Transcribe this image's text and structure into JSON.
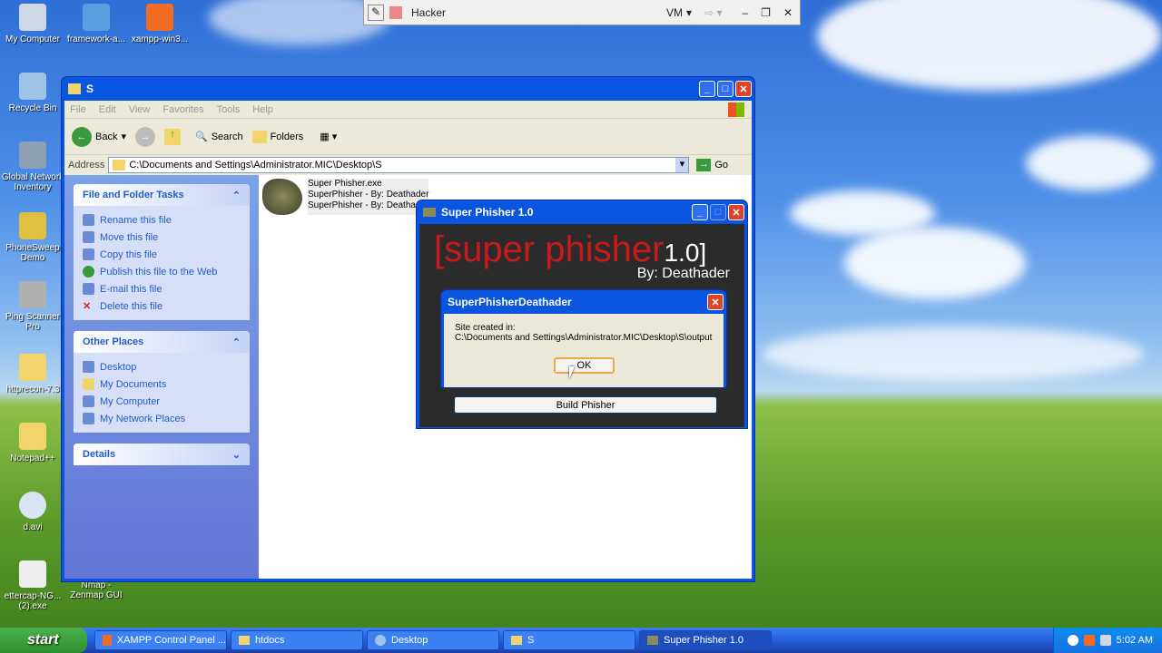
{
  "vm_bar": {
    "title": "Hacker",
    "vm_label": "VM"
  },
  "desktop_icons": [
    {
      "label": "My Computer"
    },
    {
      "label": "framework-a..."
    },
    {
      "label": "xampp-win3..."
    },
    {
      "label": "Recycle Bin"
    },
    {
      "label": "Global Network Inventory"
    },
    {
      "label": "PhoneSweep Demo"
    },
    {
      "label": "Ping Scanner Pro"
    },
    {
      "label": "httprecon-7.3"
    },
    {
      "label": "Notepad++"
    },
    {
      "label": "d.avi"
    },
    {
      "label": "ettercap-NG... (2).exe"
    },
    {
      "label": "Nmap - Zenmap GUI"
    }
  ],
  "explorer": {
    "title": "S",
    "menu": [
      "File",
      "Edit",
      "View",
      "Favorites",
      "Tools",
      "Help"
    ],
    "toolbar": {
      "back": "Back",
      "search": "Search",
      "folders": "Folders"
    },
    "address_label": "Address",
    "address_value": "C:\\Documents and Settings\\Administrator.MIC\\Desktop\\S",
    "go_label": "Go",
    "file_tasks": {
      "title": "File and Folder Tasks",
      "items": [
        "Rename this file",
        "Move this file",
        "Copy this file",
        "Publish this file to the Web",
        "E-mail this file",
        "Delete this file"
      ]
    },
    "other_places": {
      "title": "Other Places",
      "items": [
        "Desktop",
        "My Documents",
        "My Computer",
        "My Network Places"
      ]
    },
    "details": {
      "title": "Details"
    },
    "file": {
      "name": "Super Phisher.exe",
      "line2": "SuperPhisher - By: Deathader",
      "line3": "SuperPhisher - By: Deathader"
    }
  },
  "phisher": {
    "title": "Super Phisher 1.0",
    "logo_main": "[super phisher",
    "logo_version": "1.0]",
    "logo_by": "By: Deathader",
    "build_button": "Build Phisher"
  },
  "dialog": {
    "title": "SuperPhisherDeathader",
    "line1": "Site created in:",
    "line2": "C:\\Documents and Settings\\Administrator.MIC\\Desktop\\S\\output",
    "ok_label": "OK"
  },
  "taskbar": {
    "start_label": "start",
    "tasks": [
      "XAMPP Control Panel ...",
      "htdocs",
      "Desktop",
      "S",
      "Super Phisher 1.0"
    ],
    "clock": "5:02 AM"
  }
}
